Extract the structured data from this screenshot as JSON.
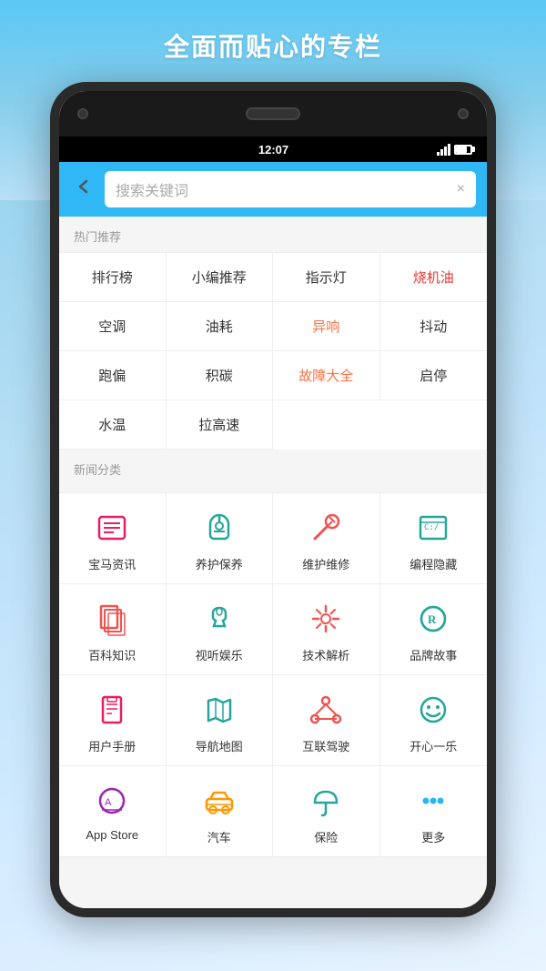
{
  "page": {
    "title": "全面而贴心的专栏",
    "bg_color": "#5bc8f5"
  },
  "status_bar": {
    "time": "12:07"
  },
  "search_bar": {
    "placeholder": "搜索关键词",
    "back_label": "←",
    "clear_label": "×"
  },
  "hot_section": {
    "label": "热门推荐",
    "tags": [
      {
        "text": "排行榜",
        "color": "normal"
      },
      {
        "text": "小编推荐",
        "color": "normal"
      },
      {
        "text": "指示灯",
        "color": "normal"
      },
      {
        "text": "烧机油",
        "color": "red"
      },
      {
        "text": "空调",
        "color": "normal"
      },
      {
        "text": "油耗",
        "color": "normal"
      },
      {
        "text": "异响",
        "color": "orange"
      },
      {
        "text": "抖动",
        "color": "normal"
      },
      {
        "text": "跑偏",
        "color": "normal"
      },
      {
        "text": "积碳",
        "color": "normal"
      },
      {
        "text": "故障大全",
        "color": "orange"
      },
      {
        "text": "启停",
        "color": "normal"
      },
      {
        "text": "水温",
        "color": "normal"
      },
      {
        "text": "拉高速",
        "color": "normal"
      }
    ]
  },
  "news_section": {
    "label": "新闻分类",
    "categories": [
      {
        "label": "宝马资讯",
        "icon": "news"
      },
      {
        "label": "养护保养",
        "icon": "maintenance"
      },
      {
        "label": "维护维修",
        "icon": "repair"
      },
      {
        "label": "编程隐藏",
        "icon": "programming"
      },
      {
        "label": "百科知识",
        "icon": "encyclopedia"
      },
      {
        "label": "视听娱乐",
        "icon": "entertainment"
      },
      {
        "label": "技术解析",
        "icon": "tech"
      },
      {
        "label": "品牌故事",
        "icon": "brand"
      },
      {
        "label": "用户手册",
        "icon": "manual"
      },
      {
        "label": "导航地图",
        "icon": "map"
      },
      {
        "label": "互联驾驶",
        "icon": "connected"
      },
      {
        "label": "开心一乐",
        "icon": "fun"
      },
      {
        "label": "App Store",
        "icon": "appstore"
      },
      {
        "label": "汽车",
        "icon": "car"
      },
      {
        "label": "保险",
        "icon": "umbrella"
      },
      {
        "label": "更多",
        "icon": "more"
      }
    ]
  },
  "icons": {
    "news_color": "#e91e63",
    "maintenance_color": "#26a69a",
    "repair_color": "#ef5350",
    "programming_color": "#26a69a",
    "encyclopedia_color": "#ef5350",
    "entertainment_color": "#26a69a",
    "tech_color": "#ef5350",
    "brand_color": "#26a69a",
    "manual_color": "#e91e63",
    "map_color": "#26a69a",
    "connected_color": "#ef5350",
    "fun_color": "#26a69a",
    "appstore_color": "#9c27b0",
    "car_color": "#ff9800",
    "umbrella_color": "#26a69a",
    "more_color": "#29b6f6"
  }
}
